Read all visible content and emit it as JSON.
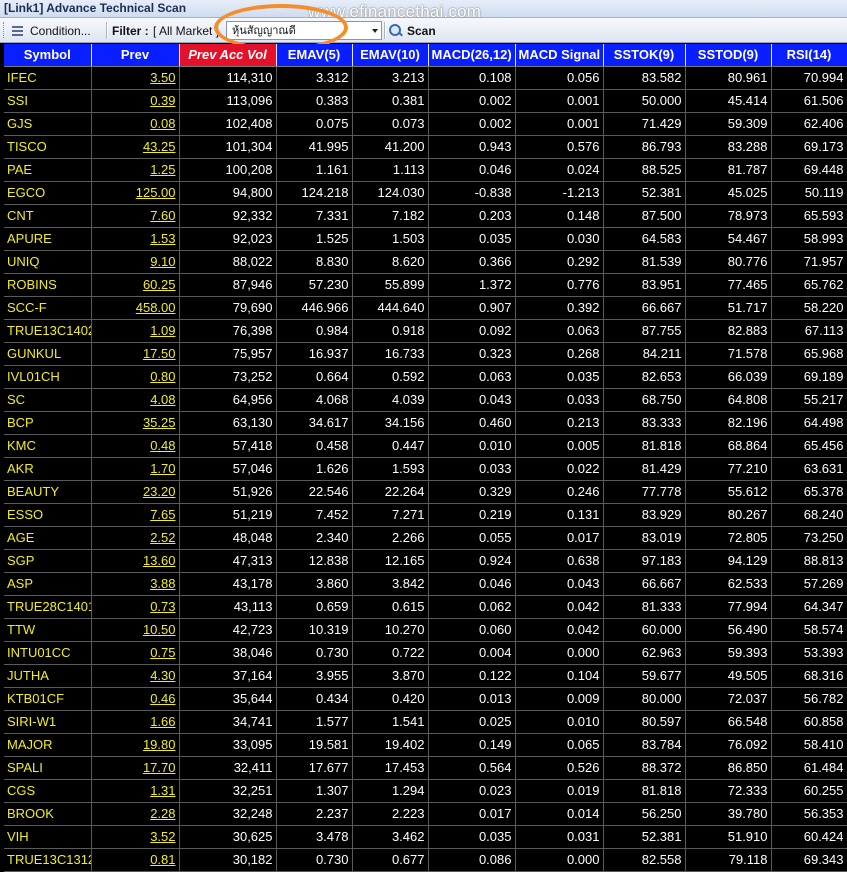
{
  "window": {
    "title": "[Link1] Advance Technical Scan"
  },
  "watermark": "www.efinancethai.com",
  "toolbar": {
    "condition_label": "Condition...",
    "filter_label": "Filter :",
    "filter_value": "[ All Market ]",
    "combo_value": "หุ้นสัญญาณดี",
    "scan_label": "Scan"
  },
  "colors": {
    "header_bg": "#0a1fff",
    "active_header_bg": "#e3122a",
    "symbol_text": "#f4ee1d",
    "highlight_circle": "#f58d2a"
  },
  "columns": [
    "Symbol",
    "Prev",
    "Prev Acc Vol",
    "EMAV(5)",
    "EMAV(10)",
    "MACD(26,12)",
    "MACD Signal",
    "SSTOK(9)",
    "SSTOD(9)",
    "RSI(14)"
  ],
  "rows": [
    [
      "IFEC",
      "3.50",
      "114,310",
      "3.312",
      "3.213",
      "0.108",
      "0.056",
      "83.582",
      "80.961",
      "70.994"
    ],
    [
      "SSI",
      "0.39",
      "113,096",
      "0.383",
      "0.381",
      "0.002",
      "0.001",
      "50.000",
      "45.414",
      "61.506"
    ],
    [
      "GJS",
      "0.08",
      "102,408",
      "0.075",
      "0.073",
      "0.002",
      "0.001",
      "71.429",
      "59.309",
      "62.406"
    ],
    [
      "TISCO",
      "43.25",
      "101,304",
      "41.995",
      "41.200",
      "0.943",
      "0.576",
      "86.793",
      "83.288",
      "69.173"
    ],
    [
      "PAE",
      "1.25",
      "100,208",
      "1.161",
      "1.113",
      "0.046",
      "0.024",
      "88.525",
      "81.787",
      "69.448"
    ],
    [
      "EGCO",
      "125.00",
      "94,800",
      "124.218",
      "124.030",
      "-0.838",
      "-1.213",
      "52.381",
      "45.025",
      "50.119"
    ],
    [
      "CNT",
      "7.60",
      "92,332",
      "7.331",
      "7.182",
      "0.203",
      "0.148",
      "87.500",
      "78.973",
      "65.593"
    ],
    [
      "APURE",
      "1.53",
      "92,023",
      "1.525",
      "1.503",
      "0.035",
      "0.030",
      "64.583",
      "54.467",
      "58.993"
    ],
    [
      "UNIQ",
      "9.10",
      "88,022",
      "8.830",
      "8.620",
      "0.366",
      "0.292",
      "81.539",
      "80.776",
      "71.957"
    ],
    [
      "ROBINS",
      "60.25",
      "87,946",
      "57.230",
      "55.899",
      "1.372",
      "0.776",
      "83.951",
      "77.465",
      "65.762"
    ],
    [
      "SCC-F",
      "458.00",
      "79,690",
      "446.966",
      "444.640",
      "0.907",
      "0.392",
      "66.667",
      "51.717",
      "58.220"
    ],
    [
      "TRUE13C1402",
      "1.09",
      "76,398",
      "0.984",
      "0.918",
      "0.092",
      "0.063",
      "87.755",
      "82.883",
      "67.113"
    ],
    [
      "GUNKUL",
      "17.50",
      "75,957",
      "16.937",
      "16.733",
      "0.323",
      "0.268",
      "84.211",
      "71.578",
      "65.968"
    ],
    [
      "IVL01CH",
      "0.80",
      "73,252",
      "0.664",
      "0.592",
      "0.063",
      "0.035",
      "82.653",
      "66.039",
      "69.189"
    ],
    [
      "SC",
      "4.08",
      "64,956",
      "4.068",
      "4.039",
      "0.043",
      "0.033",
      "68.750",
      "64.808",
      "55.217"
    ],
    [
      "BCP",
      "35.25",
      "63,130",
      "34.617",
      "34.156",
      "0.460",
      "0.213",
      "83.333",
      "82.196",
      "64.498"
    ],
    [
      "KMC",
      "0.48",
      "57,418",
      "0.458",
      "0.447",
      "0.010",
      "0.005",
      "81.818",
      "68.864",
      "65.456"
    ],
    [
      "AKR",
      "1.70",
      "57,046",
      "1.626",
      "1.593",
      "0.033",
      "0.022",
      "81.429",
      "77.210",
      "63.631"
    ],
    [
      "BEAUTY",
      "23.20",
      "51,926",
      "22.546",
      "22.264",
      "0.329",
      "0.246",
      "77.778",
      "55.612",
      "65.378"
    ],
    [
      "ESSO",
      "7.65",
      "51,219",
      "7.452",
      "7.271",
      "0.219",
      "0.131",
      "83.929",
      "80.267",
      "68.240"
    ],
    [
      "AGE",
      "2.52",
      "48,048",
      "2.340",
      "2.266",
      "0.055",
      "0.017",
      "83.019",
      "72.805",
      "73.250"
    ],
    [
      "SGP",
      "13.60",
      "47,313",
      "12.838",
      "12.165",
      "0.924",
      "0.638",
      "97.183",
      "94.129",
      "88.813"
    ],
    [
      "ASP",
      "3.88",
      "43,178",
      "3.860",
      "3.842",
      "0.046",
      "0.043",
      "66.667",
      "62.533",
      "57.269"
    ],
    [
      "TRUE28C1401",
      "0.73",
      "43,113",
      "0.659",
      "0.615",
      "0.062",
      "0.042",
      "81.333",
      "77.994",
      "64.347"
    ],
    [
      "TTW",
      "10.50",
      "42,723",
      "10.319",
      "10.270",
      "0.060",
      "0.042",
      "60.000",
      "56.490",
      "58.574"
    ],
    [
      "INTU01CC",
      "0.75",
      "38,046",
      "0.730",
      "0.722",
      "0.004",
      "0.000",
      "62.963",
      "59.393",
      "53.393"
    ],
    [
      "JUTHA",
      "4.30",
      "37,164",
      "3.955",
      "3.870",
      "0.122",
      "0.104",
      "59.677",
      "49.505",
      "68.316"
    ],
    [
      "KTB01CF",
      "0.46",
      "35,644",
      "0.434",
      "0.420",
      "0.013",
      "0.009",
      "80.000",
      "72.037",
      "56.782"
    ],
    [
      "SIRI-W1",
      "1.66",
      "34,741",
      "1.577",
      "1.541",
      "0.025",
      "0.010",
      "80.597",
      "66.548",
      "60.858"
    ],
    [
      "MAJOR",
      "19.80",
      "33,095",
      "19.581",
      "19.402",
      "0.149",
      "0.065",
      "83.784",
      "76.092",
      "58.410"
    ],
    [
      "SPALI",
      "17.70",
      "32,411",
      "17.677",
      "17.453",
      "0.564",
      "0.526",
      "88.372",
      "86.850",
      "61.484"
    ],
    [
      "CGS",
      "1.31",
      "32,251",
      "1.307",
      "1.294",
      "0.023",
      "0.019",
      "81.818",
      "72.333",
      "60.255"
    ],
    [
      "BROOK",
      "2.28",
      "32,248",
      "2.237",
      "2.223",
      "0.017",
      "0.014",
      "56.250",
      "39.780",
      "56.353"
    ],
    [
      "VIH",
      "3.52",
      "30,625",
      "3.478",
      "3.462",
      "0.035",
      "0.031",
      "52.381",
      "51.910",
      "60.424"
    ],
    [
      "TRUE13C1312",
      "0.81",
      "30,182",
      "0.730",
      "0.677",
      "0.086",
      "0.000",
      "82.558",
      "79.118",
      "69.343"
    ]
  ]
}
